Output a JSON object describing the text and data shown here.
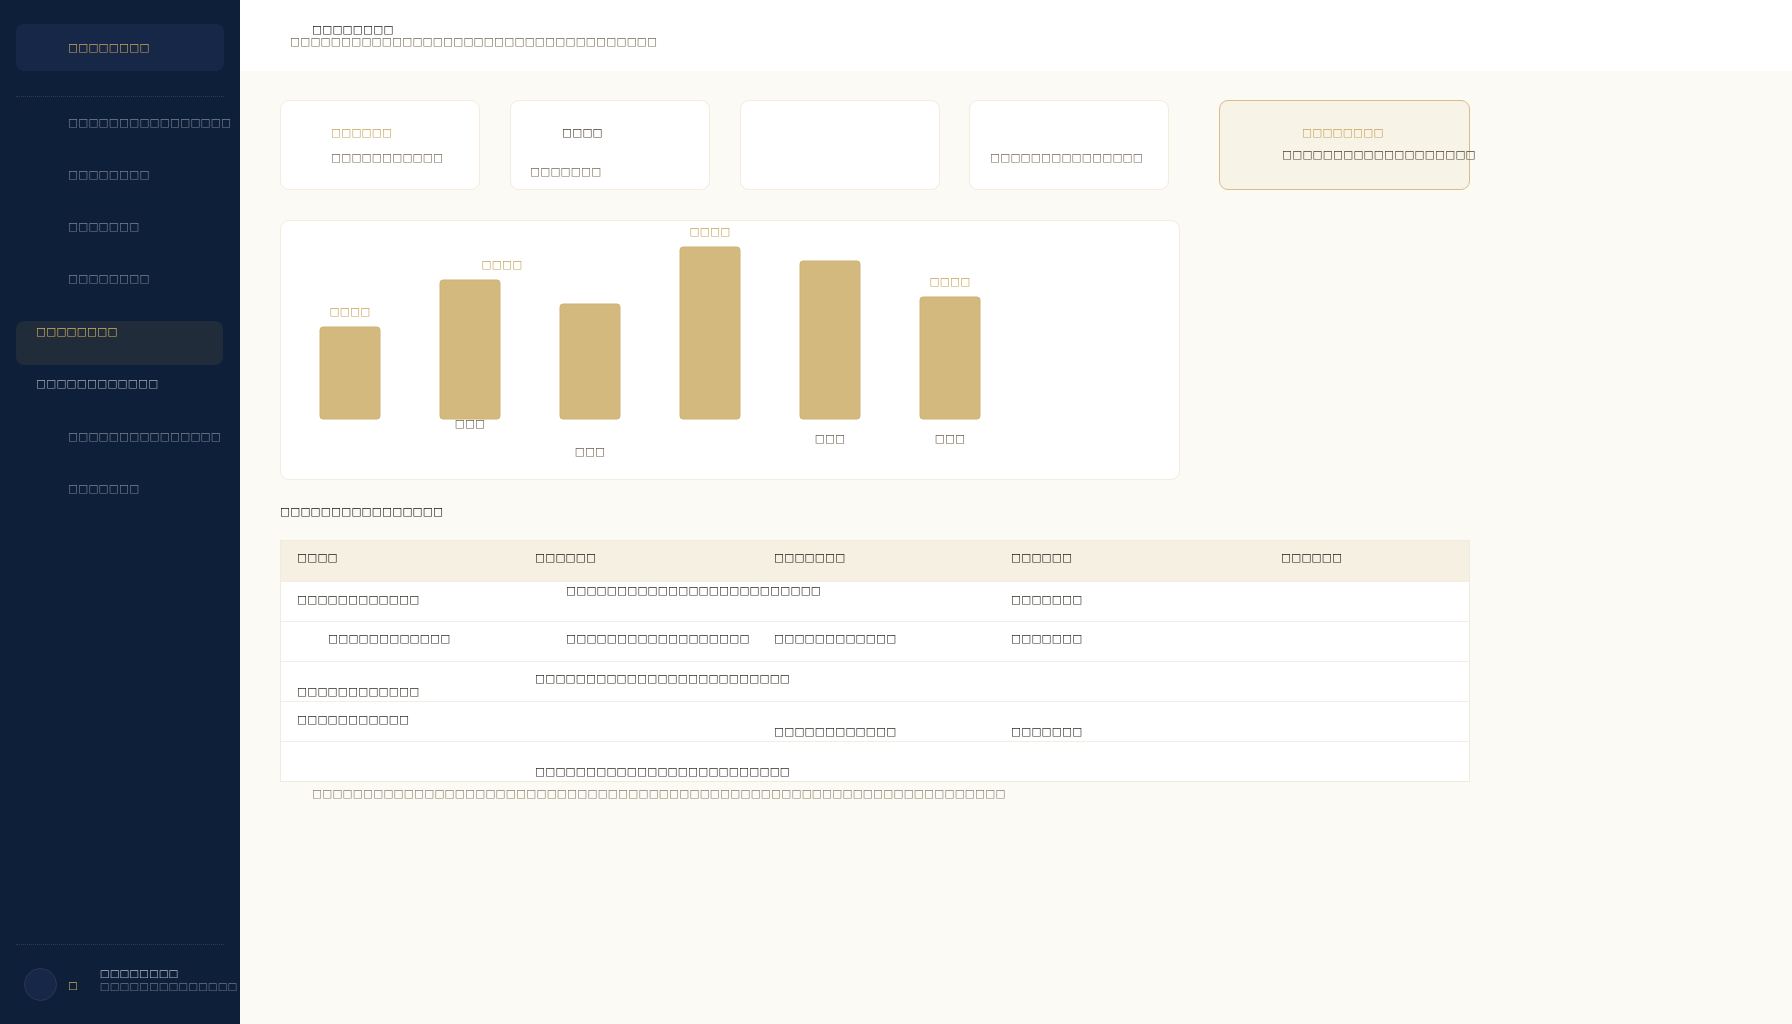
{
  "sidebar": {
    "brand": "□□□□□□□□",
    "nav_items": [
      {
        "label": "□□□□□□□□□□□□□□□□",
        "kind": "link",
        "selected": false
      },
      {
        "label": "□□□□□□□□",
        "kind": "link",
        "selected": false
      },
      {
        "label": "□□□□□□□",
        "kind": "link",
        "selected": false
      },
      {
        "label": "□□□□□□□□",
        "kind": "link",
        "selected": false
      },
      {
        "label": "□□□□□□□□",
        "kind": "section",
        "selected": true
      },
      {
        "label": "□□□□□□□□□□□□",
        "kind": "section",
        "selected": false
      },
      {
        "label": "□□□□□□□□□□□□□□□",
        "kind": "link",
        "selected": false
      },
      {
        "label": "□□□□□□□",
        "kind": "link",
        "selected": false
      }
    ],
    "user": {
      "glyph": "□",
      "name": "□□□□□□□□",
      "subtitle": "□□□□□□□□□□□□□□"
    }
  },
  "header": {
    "title": "□□□□□□□□",
    "subtitle": "□□□□□□□□□□□□□□□□□□□□□□□□□□□□□□□□□□□□"
  },
  "stat_cards": [
    {
      "label": {
        "text": "□□□□□□",
        "kind": "accent"
      },
      "value": "□□□□□□□□□□□",
      "selected": false
    },
    {
      "label": {
        "text": "□□□□",
        "kind": "plain"
      },
      "value": "□□□□□□□",
      "selected": false
    },
    {
      "selected": false
    },
    {
      "value": "□□□□□□□□□□□□□□□",
      "selected": false
    },
    {
      "label": {
        "text": "□□□□□□□□",
        "kind": "accent"
      },
      "value": "□□□□□□□□□□□□□□□□□□□",
      "selected": true
    }
  ],
  "chart": {
    "bars": [
      {
        "value_label": "□□□□"
      },
      {
        "value_label": "□□□□",
        "category": "□□□"
      },
      {
        "category": "□□□"
      },
      {
        "value_label": "□□□□"
      },
      {
        "category": "□□□"
      },
      {
        "value_label": "□□□□",
        "category": "□□□"
      }
    ]
  },
  "table": {
    "title": "□□□□□□□□□□□□□□□□",
    "columns": [
      "□□□□",
      "□□□□□□",
      "□□□□□□□",
      "□□□□□□",
      "□□□□□□"
    ],
    "rows": [
      {
        "column_1": "□□□□□□□□□□□□",
        "column_2": "□□□□□□□□□□□□□□□□□□□□□□□□□",
        "column_4": "□□□□□□□"
      },
      {
        "column_1": "□□□□□□□□□□□□",
        "column_2": "□□□□□□□□□□□□□□□□□□",
        "column_3": "□□□□□□□□□□□□",
        "column_4": "□□□□□□□"
      },
      {
        "column_1": "□□□□□□□□□□□□",
        "column_2": "□□□□□□□□□□□□□□□□□□□□□□□□□"
      },
      {
        "column_1": "□□□□□□□□□□□",
        "column_3": "□□□□□□□□□□□□",
        "column_4": "□□□□□□□"
      },
      {
        "column_2": "□□□□□□□□□□□□□□□□□□□□□□□□□"
      }
    ],
    "footnote": "□□□□□□□□□□□□□□□□□□□□□□□□□□□□□□□□□□□□□□□□□□□□□□□□□□□□□□□□□□□□□□□□□□□□"
  }
}
